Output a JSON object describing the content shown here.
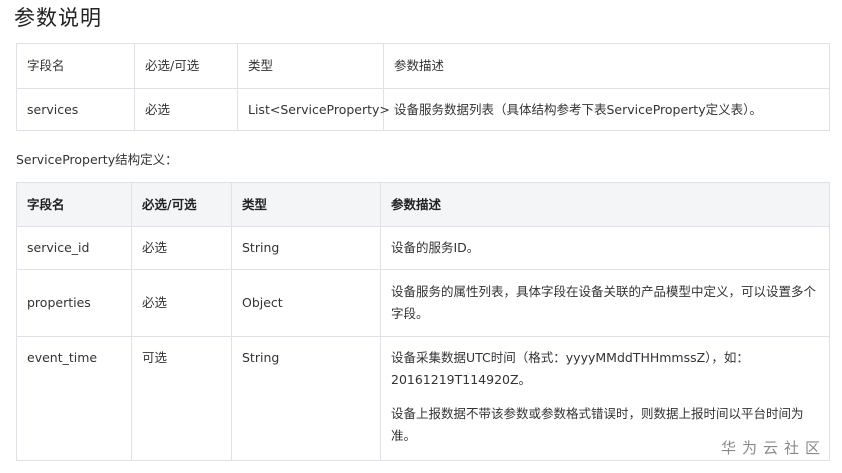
{
  "page_title": "参数说明",
  "table1": {
    "headers": [
      "字段名",
      "必选/可选",
      "类型",
      "参数描述"
    ],
    "rows": [
      [
        "services",
        "必选",
        "List<ServiceProperty>",
        "设备服务数据列表（具体结构参考下表ServiceProperty定义表）。"
      ]
    ]
  },
  "subtitle": "ServiceProperty结构定义：",
  "table2": {
    "headers": [
      "字段名",
      "必选/可选",
      "类型",
      "参数描述"
    ],
    "rows": [
      {
        "field": "service_id",
        "required": "必选",
        "type": "String",
        "desc": [
          "设备的服务ID。"
        ]
      },
      {
        "field": "properties",
        "required": "必选",
        "type": "Object",
        "desc": [
          "设备服务的属性列表，具体字段在设备关联的产品模型中定义，可以设置多个字段。"
        ]
      },
      {
        "field": "event_time",
        "required": "可选",
        "type": "String",
        "desc": [
          "设备采集数据UTC时间（格式：yyyyMMddTHHmmssZ），如：20161219T114920Z。",
          "设备上报数据不带该参数或参数格式错误时，则数据上报时间以平台时间为准。"
        ]
      }
    ]
  },
  "watermark": "华为云社区"
}
